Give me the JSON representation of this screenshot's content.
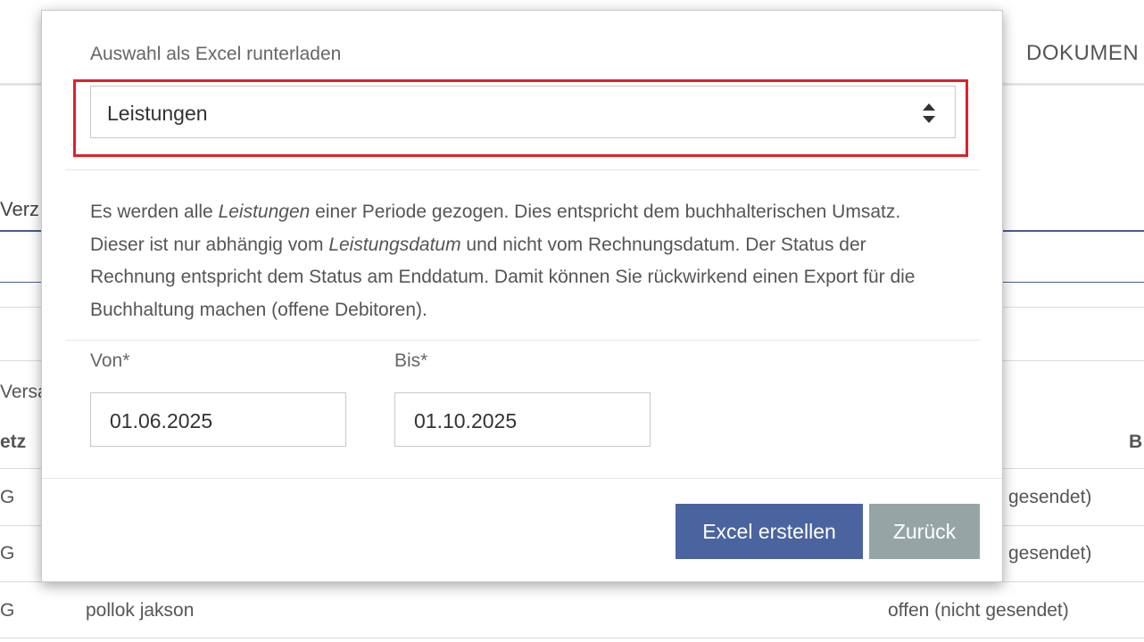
{
  "background": {
    "nav_dokumente": "DOKUMEN",
    "tab_label": "Verz",
    "row_label_versa": "Versa",
    "col_header_left": "etz",
    "col_header_right": "B",
    "rows": [
      {
        "left": "G",
        "middle": "",
        "right": "gesendet)"
      },
      {
        "left": "G",
        "middle": "",
        "right": "gesendet)"
      },
      {
        "left": "G",
        "middle": "pollok jakson",
        "right": "offen (nicht gesendet)"
      }
    ]
  },
  "modal": {
    "title": "Auswahl als Excel runterladen",
    "select": {
      "value": "Leistungen"
    },
    "description": {
      "part1": "Es werden alle ",
      "em1": "Leistungen",
      "part2": " einer Periode gezogen. Dies entspricht dem buchhalterischen Umsatz. Dieser ist nur abhängig vom ",
      "em2": "Leistungsdatum",
      "part3": " und nicht vom Rechnungsdatum. Der Status der Rechnung entspricht dem Status am Enddatum. Damit können Sie rückwirkend einen Export für die Buchhaltung machen (offene Debitoren)."
    },
    "from": {
      "label": "Von*",
      "value": "01.06.2025"
    },
    "to": {
      "label": "Bis*",
      "value": "01.10.2025"
    },
    "buttons": {
      "create": "Excel erstellen",
      "back": "Zurück"
    }
  },
  "colors": {
    "highlight": "#e0202a",
    "primary": "#4a64a0",
    "secondary": "#95a5a6"
  }
}
